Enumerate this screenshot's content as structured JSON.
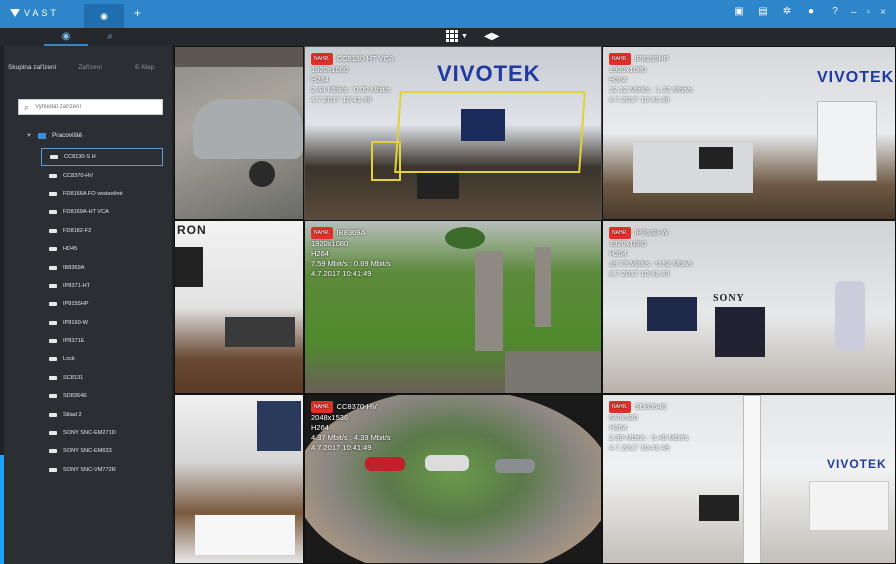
{
  "app": {
    "brand": "VAST",
    "live_tab": "",
    "add_tab": "+",
    "toolbar_icons": [
      "export-icon",
      "chart-icon",
      "gear-icon",
      "user-icon",
      "help-icon"
    ],
    "window_controls": [
      "–",
      "▫",
      "×"
    ]
  },
  "subbar": {
    "tabs": [
      "",
      ""
    ],
    "layout_button": "grid-layout-icon",
    "sequence_button": "sequence-icon"
  },
  "sidebar": {
    "tabs": [
      "Skupina zařízení",
      "Zařízení",
      "E-Map"
    ],
    "search_placeholder": "Vyhledat zařízení",
    "root_label": "Pracoviště",
    "cameras": [
      "CC8130-S H",
      "CC8370-HV",
      "FD8166A FO vestavěné",
      "FD8169A-HT VCA",
      "FD8182-F2",
      "HD45",
      "IB8369A",
      "IP8371-HT",
      "IP8155HP",
      "IP8160-W",
      "IP8371E",
      "Lock",
      "SC8131",
      "SD8364E",
      "Sklad 2",
      "SONY SNC-EM271D",
      "SONY SNC-EM633",
      "SONY SNC-VM772R"
    ],
    "selected_camera_index": 0
  },
  "tiles": [
    {
      "label": "",
      "osd": []
    },
    {
      "label": "CC8130-HT VCA",
      "osd": [
        "1920x1080",
        "H264",
        "2.44 Mbit/s : 0.00 Mbit/s",
        "4.7.2017 10:41:49"
      ],
      "logo": "VIVOTEK"
    },
    {
      "label": "IP8165HP",
      "osd": [
        "1920x1080",
        "H264",
        "12.12 Mbit/s : 1.32 Mbit/s",
        "4.7.2017 10:41:49"
      ],
      "logo": "VIVOTEK"
    },
    {
      "label": "",
      "osd": [],
      "logo": "RON"
    },
    {
      "label": "IB8369A",
      "osd": [
        "1920x1080",
        "H264",
        "7.59 Mbit/s : 0.69 Mbit/s",
        "4.7.2017 10:41:49"
      ]
    },
    {
      "label": "IP8160-W",
      "osd": [
        "1920x1080",
        "H264",
        "18.73 Mbit/s : 0.52 Mbit/s",
        "4.7.2017 10:41:49"
      ],
      "logo": "SONY"
    },
    {
      "label": "",
      "osd": []
    },
    {
      "label": "CC8370-HV",
      "osd": [
        "2048x1536",
        "H264",
        "4.37 Mbit/s : 4.39 Mbit/s",
        "4.7.2017 10:41:49"
      ]
    },
    {
      "label": "SD8364E",
      "osd": [
        "640x480",
        "H264",
        "2.99 Mbit/s : 0.48 Mbit/s",
        "4.7.2017 10:41:49"
      ],
      "logo": "VIVOTEK"
    }
  ],
  "colors": {
    "accent": "#2d86c9",
    "sidebar_bg": "#2b2f33",
    "rec_badge": "#e0302a"
  },
  "rec_badge_label": "NAHR."
}
